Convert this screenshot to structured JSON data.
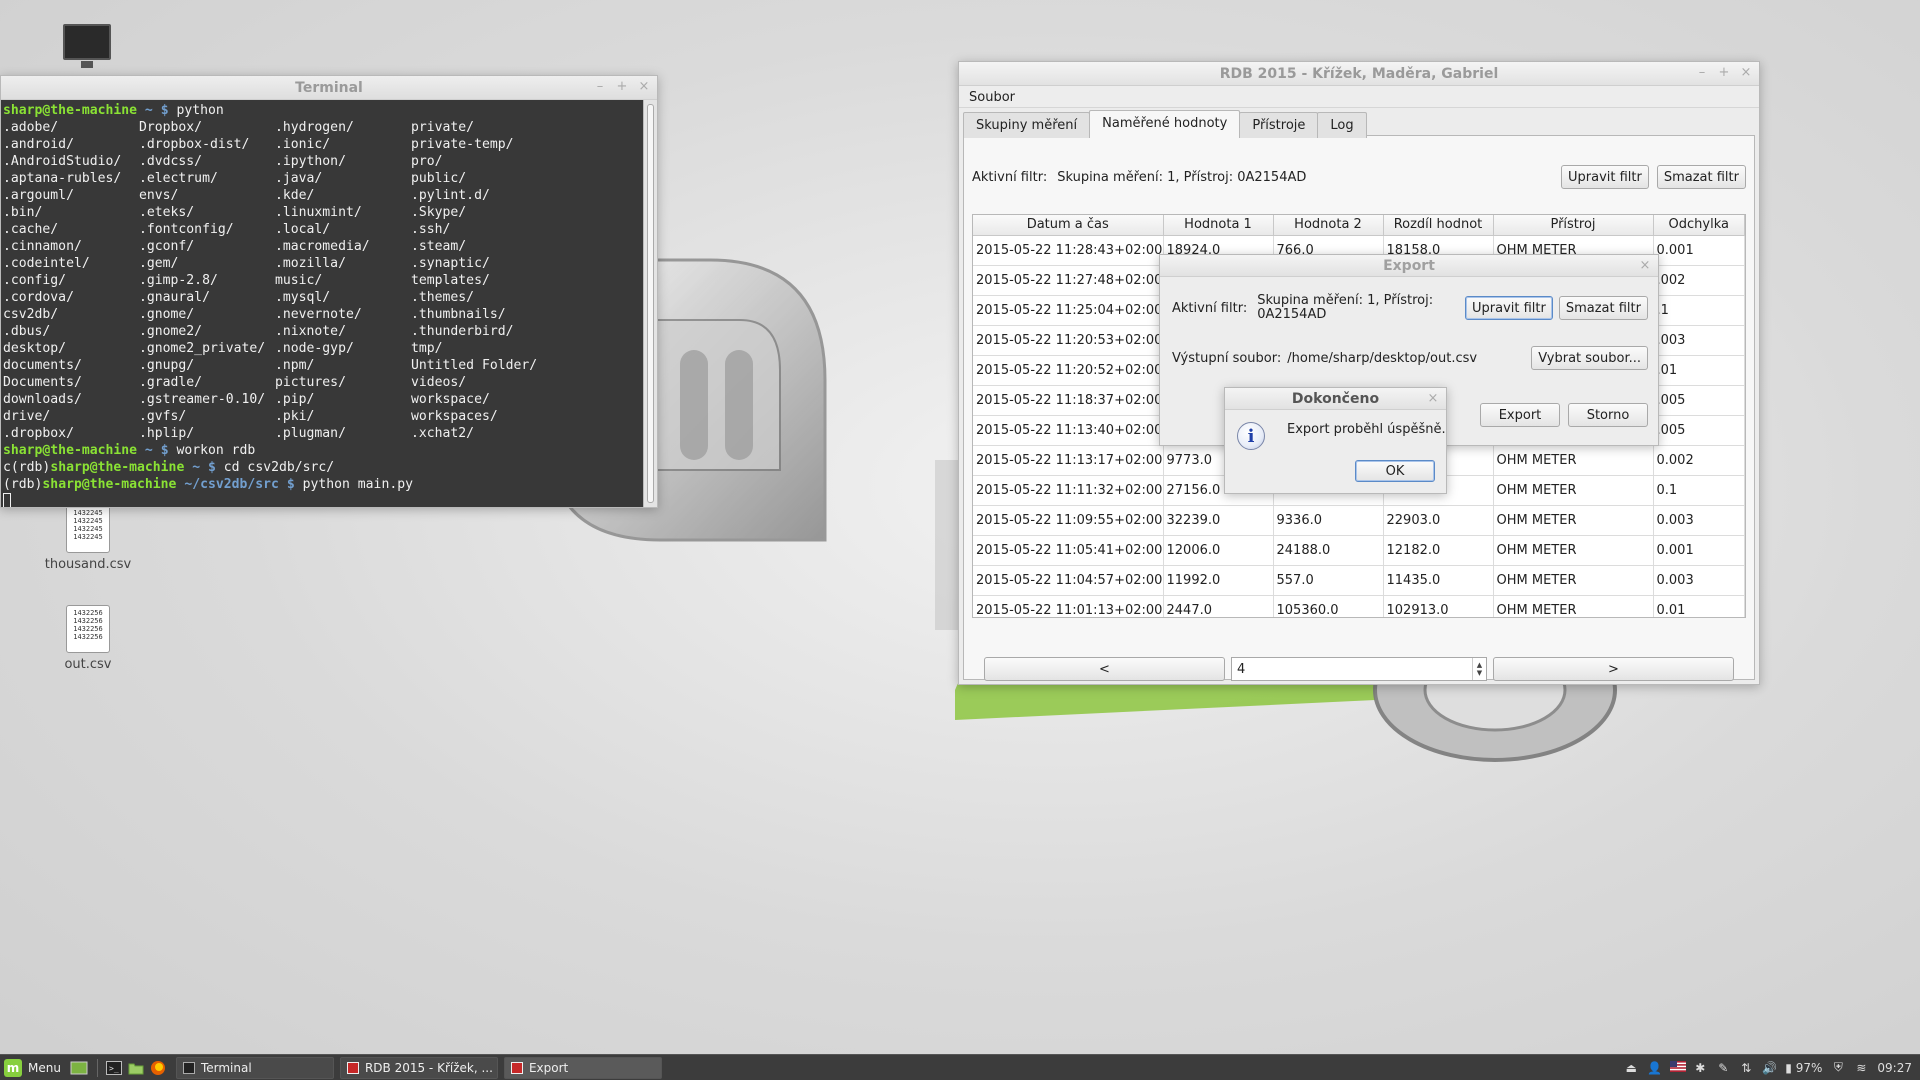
{
  "colors": {
    "terminal_bg": "#383838",
    "prompt_user": "#8ae234",
    "prompt_path": "#729fcf",
    "mint_green": "#87cf3e"
  },
  "desktop": {
    "icons": [
      {
        "label": "thousand.csv",
        "preview": "1432245\n1432245\n1432245\n1432245"
      },
      {
        "label": "out.csv",
        "preview": "1432256\n1432256\n1432256\n1432256"
      }
    ],
    "computer_icon": "computer-icon"
  },
  "terminal": {
    "title": "Terminal",
    "prompt_user": "sharp@the-machine",
    "cmd1": "python",
    "ls_entries": [
      ".adobe/",
      "Dropbox/",
      ".hydrogen/",
      "private/",
      ".android/",
      ".dropbox-dist/",
      ".ionic/",
      "private-temp/",
      ".AndroidStudio/",
      ".dvdcss/",
      ".ipython/",
      "pro/",
      ".aptana-rubles/",
      ".electrum/",
      ".java/",
      "public/",
      ".argouml/",
      "envs/",
      ".kde/",
      ".pylint.d/",
      ".bin/",
      ".eteks/",
      ".linuxmint/",
      ".Skype/",
      ".cache/",
      ".fontconfig/",
      ".local/",
      ".ssh/",
      ".cinnamon/",
      ".gconf/",
      ".macromedia/",
      ".steam/",
      ".codeintel/",
      ".gem/",
      ".mozilla/",
      ".synaptic/",
      ".config/",
      ".gimp-2.8/",
      "music/",
      "templates/",
      ".cordova/",
      ".gnaural/",
      ".mysql/",
      ".themes/",
      "csv2db/",
      ".gnome/",
      ".nevernote/",
      ".thumbnails/",
      ".dbus/",
      ".gnome2/",
      ".nixnote/",
      ".thunderbird/",
      "desktop/",
      ".gnome2_private/",
      ".node-gyp/",
      "tmp/",
      "documents/",
      ".gnupg/",
      ".npm/",
      "Untitled Folder/",
      "Documents/",
      ".gradle/",
      "pictures/",
      "videos/",
      "downloads/",
      ".gstreamer-0.10/",
      ".pip/",
      "workspace/",
      "drive/",
      ".gvfs/",
      ".pki/",
      "workspaces/",
      ".dropbox/",
      ".hplip/",
      ".plugman/",
      ".xchat2/"
    ],
    "tilde": "~",
    "dollar": "$",
    "cmd2": "workon rdb",
    "line3_prefix": "c(rdb)",
    "cmd3": "cd csv2db/src/",
    "line4_prefix": "(rdb)",
    "line4_path": "~/csv2db/src",
    "cmd4": "python main.py"
  },
  "rdb": {
    "title": "RDB 2015 - Křížek, Maděra, Gabriel",
    "menu": [
      "Soubor"
    ],
    "tabs": [
      "Skupiny měření",
      "Naměřené hodnoty",
      "Přístroje",
      "Log"
    ],
    "active_tab": 1,
    "filter_label": "Aktivní filtr:",
    "filter_value": "Skupina měření: 1, Přístroj: 0A2154AD",
    "edit_filter_btn": "Upravit filtr",
    "clear_filter_btn": "Smazat filtr",
    "columns": [
      "Datum a čas",
      "Hodnota 1",
      "Hodnota 2",
      "Rozdíl hodnot",
      "Přístroj",
      "Odchylka"
    ],
    "rows": [
      [
        "2015-05-22 11:28:43+02:00",
        "18924.0",
        "766.0",
        "18158.0",
        "OHM METER",
        "0.001"
      ],
      [
        "2015-05-22 11:27:48+02:00",
        "",
        "",
        "",
        "",
        ".002"
      ],
      [
        "2015-05-22 11:25:04+02:00",
        "",
        "",
        "",
        "",
        ".1"
      ],
      [
        "2015-05-22 11:20:53+02:00",
        "",
        "",
        "",
        "",
        ".003"
      ],
      [
        "2015-05-22 11:20:52+02:00",
        "",
        "",
        "",
        "",
        ".01"
      ],
      [
        "2015-05-22 11:18:37+02:00",
        "",
        "",
        "",
        "",
        ".005"
      ],
      [
        "2015-05-22 11:13:40+02:00",
        "",
        "",
        "",
        "",
        ".005"
      ],
      [
        "2015-05-22 11:13:17+02:00",
        "9773.0",
        "",
        "",
        "OHM METER",
        "0.002"
      ],
      [
        "2015-05-22 11:11:32+02:00",
        "27156.0",
        "",
        "",
        "OHM METER",
        "0.1"
      ],
      [
        "2015-05-22 11:09:55+02:00",
        "32239.0",
        "9336.0",
        "22903.0",
        "OHM METER",
        "0.003"
      ],
      [
        "2015-05-22 11:05:41+02:00",
        "12006.0",
        "24188.0",
        "12182.0",
        "OHM METER",
        "0.001"
      ],
      [
        "2015-05-22 11:04:57+02:00",
        "11992.0",
        "557.0",
        "11435.0",
        "OHM METER",
        "0.003"
      ],
      [
        "2015-05-22 11:01:13+02:00",
        "2447.0",
        "105360.0",
        "102913.0",
        "OHM METER",
        "0.01"
      ]
    ],
    "prev_btn": "<",
    "next_btn": ">",
    "page": "4"
  },
  "export_dialog": {
    "title": "Export",
    "filter_label": "Aktivní filtr:",
    "filter_value_line1": "Skupina měření: 1, Přístroj:",
    "filter_value_line2": "0A2154AD",
    "edit_filter_btn": "Upravit filtr",
    "clear_filter_btn": "Smazat filtr",
    "output_label": "Výstupní soubor:",
    "output_path": "/home/sharp/desktop/out.csv",
    "choose_file_btn": "Vybrat soubor...",
    "export_btn": "Export",
    "cancel_btn": "Storno"
  },
  "message_box": {
    "title": "Dokončeno",
    "text": "Export proběhl úspěšně.",
    "ok_btn": "OK",
    "icon": "info-icon"
  },
  "taskbar": {
    "menu_label": "Menu",
    "tasks": [
      {
        "label": "Terminal",
        "icon": "terminal-icon"
      },
      {
        "label": "RDB 2015 - Křížek, ...",
        "icon": "app-icon"
      },
      {
        "label": "Export",
        "icon": "app-icon"
      }
    ],
    "battery": "97%",
    "clock": "09:27"
  }
}
